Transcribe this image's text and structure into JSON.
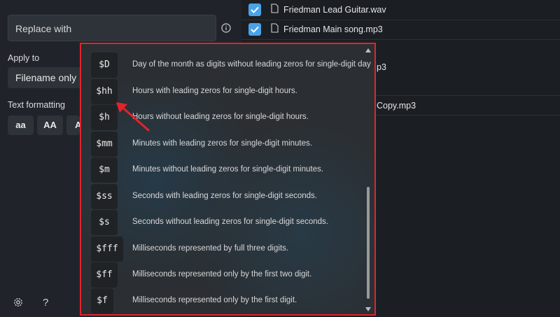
{
  "left_panel": {
    "replace_placeholder": "Replace with",
    "apply_to_label": "Apply to",
    "apply_to_value": "Filename only",
    "text_formatting_label": "Text formatting",
    "format_buttons": [
      "aa",
      "AA",
      "A"
    ]
  },
  "files": [
    {
      "name": "Friedman Lead Guitar.wav",
      "checked": true
    },
    {
      "name": "Friedman Main song.mp3",
      "checked": true
    }
  ],
  "file_fragments": [
    "p3",
    "Copy.mp3"
  ],
  "tokens": [
    {
      "token": "$D",
      "description": "Day of the month as digits without leading zeros for single-digit day"
    },
    {
      "token": "$hh",
      "description": "Hours with leading zeros for single-digit hours."
    },
    {
      "token": "$h",
      "description": "Hours without leading zeros for single-digit hours."
    },
    {
      "token": "$mm",
      "description": "Minutes with leading zeros for single-digit minutes."
    },
    {
      "token": "$m",
      "description": "Minutes without leading zeros for single-digit minutes."
    },
    {
      "token": "$ss",
      "description": "Seconds with leading zeros for single-digit seconds."
    },
    {
      "token": "$s",
      "description": "Seconds without leading zeros for single-digit seconds."
    },
    {
      "token": "$fff",
      "description": "Milliseconds represented by full three digits."
    },
    {
      "token": "$ff",
      "description": "Milliseconds represented only by the first two digit."
    },
    {
      "token": "$f",
      "description": "Milliseconds represented only by the first digit."
    }
  ],
  "colors": {
    "accent_check": "#4aa3e8",
    "highlight_border": "#e3232b",
    "annotation_arrow": "#e3232b"
  },
  "icons": {
    "info": "info-icon",
    "settings": "gear-icon",
    "help": "help-icon",
    "file": "document-icon",
    "scroll_up": "chevron-up-icon",
    "scroll_down": "chevron-down-icon"
  }
}
